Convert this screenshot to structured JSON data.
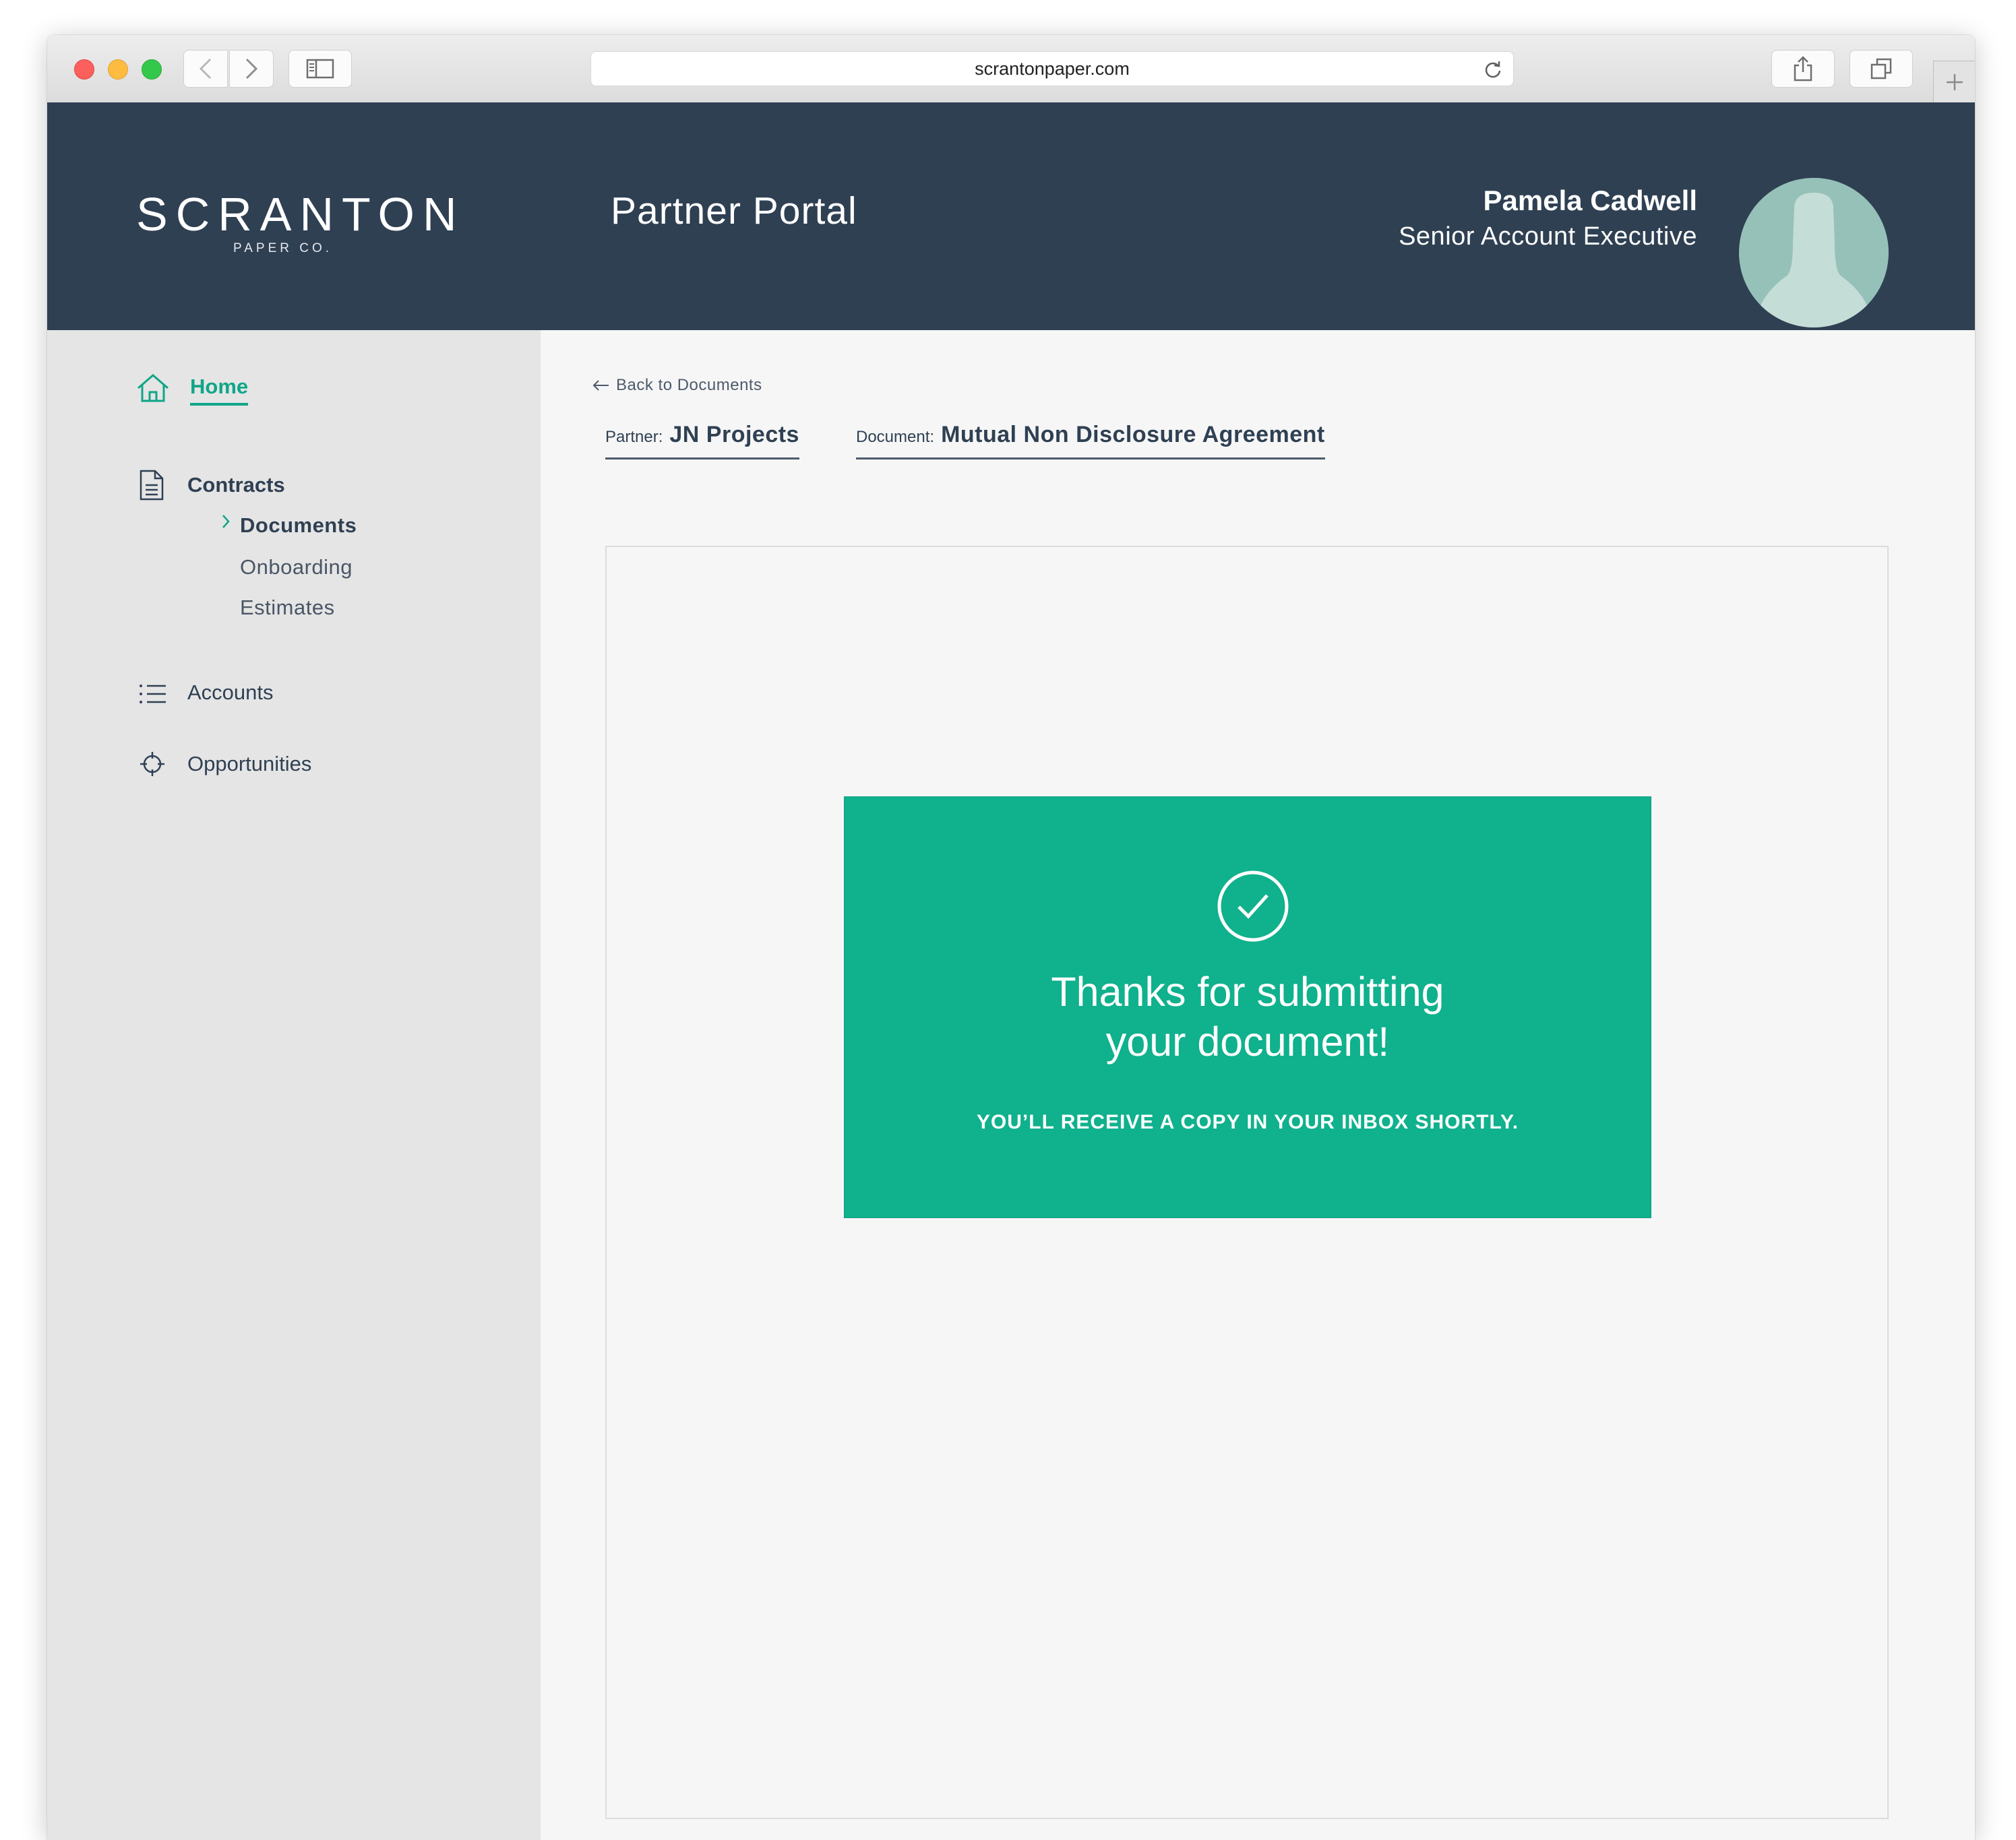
{
  "browser": {
    "url": "scrantonpaper.com",
    "icons": {
      "back": "chevron-left-icon",
      "forward": "chevron-right-icon",
      "sidebar": "sidebar-icon",
      "reload": "reload-icon",
      "share": "share-icon",
      "tabs": "tabs-icon",
      "new_tab": "plus-icon"
    }
  },
  "header": {
    "logo_main": "SCRANTON",
    "logo_sub": "PAPER CO.",
    "title": "Partner Portal",
    "user": {
      "name": "Pamela Cadwell",
      "role": "Senior Account Executive"
    }
  },
  "sidebar": {
    "home": "Home",
    "contracts": {
      "label": "Contracts",
      "items": [
        {
          "label": "Documents",
          "active": true
        },
        {
          "label": "Onboarding",
          "active": false
        },
        {
          "label": "Estimates",
          "active": false
        }
      ]
    },
    "accounts": "Accounts",
    "opportunities": "Opportunities"
  },
  "main": {
    "back_link": "Back to Documents",
    "partner_label": "Partner:",
    "partner_value": "JN Projects",
    "document_label": "Document:",
    "document_value": "Mutual Non Disclosure Agreement",
    "success": {
      "title_line1": "Thanks for submitting",
      "title_line2": "your document!",
      "note": "YOU’LL RECEIVE A COPY IN YOUR INBOX SHORTLY."
    }
  },
  "colors": {
    "header_bg": "#2f4053",
    "accent": "#10a688",
    "success_bg": "#10b18d",
    "sidebar_bg": "#e5e5e5"
  }
}
